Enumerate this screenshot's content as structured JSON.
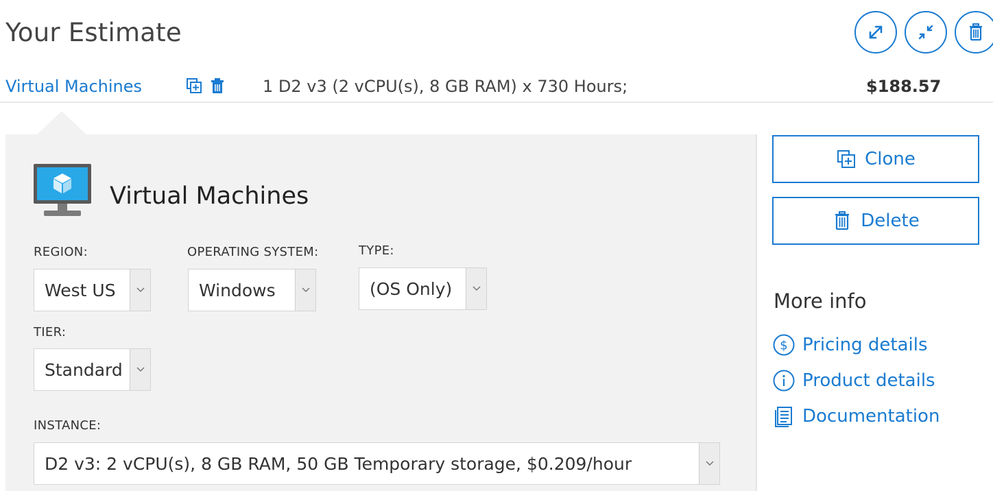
{
  "header": {
    "title": "Your Estimate",
    "actions": [
      {
        "icon": "expand-icon"
      },
      {
        "icon": "collapse-icon"
      },
      {
        "icon": "trash-icon"
      }
    ]
  },
  "estimate_row": {
    "service_name": "Virtual Machines",
    "description": "1 D2 v3 (2 vCPU(s), 8 GB RAM) x 730 Hours;",
    "price": "$188.57"
  },
  "config_panel": {
    "title": "Virtual Machines",
    "fields": {
      "region": {
        "label": "REGION:",
        "value": "West US"
      },
      "operating_system": {
        "label": "OPERATING SYSTEM:",
        "value": "Windows"
      },
      "type": {
        "label": "TYPE:",
        "value": "(OS Only)"
      },
      "tier": {
        "label": "TIER:",
        "value": "Standard"
      },
      "instance": {
        "label": "INSTANCE:",
        "value": "D2 v3: 2 vCPU(s), 8 GB RAM, 50 GB Temporary storage, $0.209/hour"
      }
    }
  },
  "sidebar": {
    "clone_label": "Clone",
    "delete_label": "Delete",
    "more_info_title": "More info",
    "links": [
      {
        "label": "Pricing details",
        "icon": "dollar-circle-icon"
      },
      {
        "label": "Product details",
        "icon": "info-circle-icon"
      },
      {
        "label": "Documentation",
        "icon": "document-icon"
      }
    ]
  },
  "colors": {
    "accent": "#1a7bd1",
    "panel_background": "#f2f2f2"
  }
}
